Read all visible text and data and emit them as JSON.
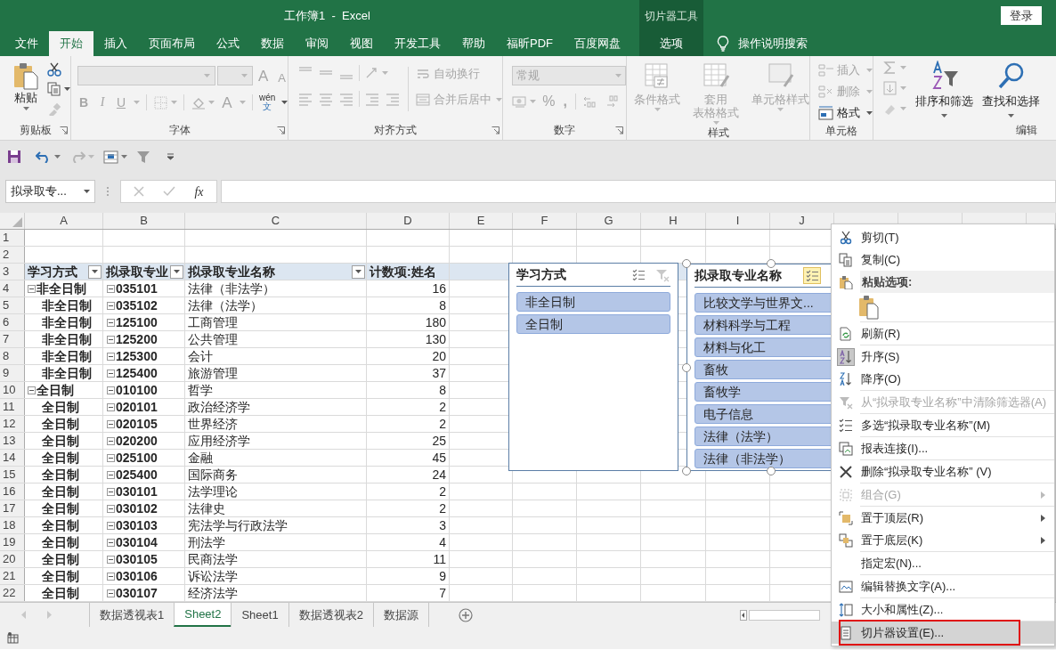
{
  "window": {
    "title": "工作簿1  -  Excel",
    "sign_in": "登录"
  },
  "ribbon_tabs": [
    {
      "label": "文件",
      "selected": false
    },
    {
      "label": "开始",
      "selected": true
    },
    {
      "label": "插入",
      "selected": false
    },
    {
      "label": "页面布局",
      "selected": false
    },
    {
      "label": "公式",
      "selected": false
    },
    {
      "label": "数据",
      "selected": false
    },
    {
      "label": "审阅",
      "selected": false
    },
    {
      "label": "视图",
      "selected": false
    },
    {
      "label": "开发工具",
      "selected": false
    },
    {
      "label": "帮助",
      "selected": false
    },
    {
      "label": "福昕PDF",
      "selected": false
    },
    {
      "label": "百度网盘",
      "selected": false
    }
  ],
  "contextual_group": {
    "label": "切片器工具",
    "tabs": [
      {
        "label": "选项",
        "selected": false
      }
    ]
  },
  "tell_me": "操作说明搜索",
  "ribbon": {
    "clipboard": {
      "label": "剪贴板",
      "paste": "粘贴"
    },
    "font": {
      "label": "字体",
      "disabled": true,
      "grow": "A",
      "shrink": "A",
      "bold": "B",
      "italic": "I",
      "underline": "U",
      "font_color": "A",
      "phonetic_top": "wén",
      "phonetic_bottom": "文"
    },
    "alignment": {
      "label": "对齐方式",
      "disabled": true,
      "wrap_text": "自动换行",
      "merge_center": "合并后居中"
    },
    "number": {
      "label": "数字",
      "disabled": true,
      "format": "常规",
      "percent": "%",
      "comma": ","
    },
    "styles": {
      "label": "样式",
      "disabled": true,
      "conditional": "条件格式",
      "table_line1": "套用",
      "table_line2": "表格格式",
      "cell_styles": "单元格样式"
    },
    "cells": {
      "label": "单元格",
      "items": [
        {
          "label": "插入",
          "disabled": true
        },
        {
          "label": "删除",
          "disabled": true
        },
        {
          "label": "格式",
          "disabled": false
        }
      ]
    },
    "editing": {
      "label": "编辑",
      "sort_filter": "排序和筛选",
      "find_select": "查找和选择"
    }
  },
  "formula_bar": {
    "name_box": "拟录取专...",
    "function_label": "fx"
  },
  "column_headers": [
    "A",
    "B",
    "C",
    "D",
    "E",
    "F",
    "G",
    "H",
    "I",
    "J"
  ],
  "row_numbers": [
    "1",
    "2",
    "3",
    "4",
    "5",
    "6",
    "7",
    "8",
    "9",
    "10",
    "11",
    "12",
    "13",
    "14",
    "15",
    "16",
    "17",
    "18",
    "19",
    "20",
    "21",
    "22"
  ],
  "pivot": {
    "headers": [
      {
        "label": "学习方式",
        "filter_button": true
      },
      {
        "label": "拟录取专业",
        "filter_button": true
      },
      {
        "label": "拟录取专业名称",
        "filter_button": true
      },
      {
        "label": "计数项:姓名",
        "filter_button": false
      }
    ],
    "rows": [
      {
        "mode": "非全日制",
        "group_start": true,
        "code": "035101",
        "name": "法律（非法学）",
        "count": "16"
      },
      {
        "mode": "非全日制",
        "group_start": false,
        "code": "035102",
        "name": "法律（法学）",
        "count": "8"
      },
      {
        "mode": "非全日制",
        "group_start": false,
        "code": "125100",
        "name": "工商管理",
        "count": "180"
      },
      {
        "mode": "非全日制",
        "group_start": false,
        "code": "125200",
        "name": "公共管理",
        "count": "130"
      },
      {
        "mode": "非全日制",
        "group_start": false,
        "code": "125300",
        "name": "会计",
        "count": "20"
      },
      {
        "mode": "非全日制",
        "group_start": false,
        "code": "125400",
        "name": "旅游管理",
        "count": "37"
      },
      {
        "mode": "全日制",
        "group_start": true,
        "code": "010100",
        "name": "哲学",
        "count": "8"
      },
      {
        "mode": "全日制",
        "group_start": false,
        "code": "020101",
        "name": "政治经济学",
        "count": "2"
      },
      {
        "mode": "全日制",
        "group_start": false,
        "code": "020105",
        "name": "世界经济",
        "count": "2"
      },
      {
        "mode": "全日制",
        "group_start": false,
        "code": "020200",
        "name": "应用经济学",
        "count": "25"
      },
      {
        "mode": "全日制",
        "group_start": false,
        "code": "025100",
        "name": "金融",
        "count": "45"
      },
      {
        "mode": "全日制",
        "group_start": false,
        "code": "025400",
        "name": "国际商务",
        "count": "24"
      },
      {
        "mode": "全日制",
        "group_start": false,
        "code": "030101",
        "name": "法学理论",
        "count": "2"
      },
      {
        "mode": "全日制",
        "group_start": false,
        "code": "030102",
        "name": "法律史",
        "count": "2"
      },
      {
        "mode": "全日制",
        "group_start": false,
        "code": "030103",
        "name": "宪法学与行政法学",
        "count": "3"
      },
      {
        "mode": "全日制",
        "group_start": false,
        "code": "030104",
        "name": "刑法学",
        "count": "4"
      },
      {
        "mode": "全日制",
        "group_start": false,
        "code": "030105",
        "name": "民商法学",
        "count": "11"
      },
      {
        "mode": "全日制",
        "group_start": false,
        "code": "030106",
        "name": "诉讼法学",
        "count": "9"
      },
      {
        "mode": "全日制",
        "group_start": false,
        "code": "030107",
        "name": "经济法学",
        "count": "7"
      }
    ]
  },
  "slicers": [
    {
      "title": "学习方式",
      "selected": false,
      "multi_select": false,
      "clear_filter": {
        "disabled": true
      },
      "items": [
        {
          "label": "非全日制",
          "selected": true
        },
        {
          "label": "全日制",
          "selected": true
        }
      ]
    },
    {
      "title": "拟录取专业名称",
      "selected": true,
      "multi_select": true,
      "items": [
        {
          "label": "比较文学与世界文...",
          "selected": true
        },
        {
          "label": "材料科学与工程",
          "selected": true
        },
        {
          "label": "材料与化工",
          "selected": true
        },
        {
          "label": "畜牧",
          "selected": true
        },
        {
          "label": "畜牧学",
          "selected": true
        },
        {
          "label": "电子信息",
          "selected": true
        },
        {
          "label": "法律（法学）",
          "selected": true
        },
        {
          "label": "法律（非法学）",
          "selected": true
        }
      ]
    }
  ],
  "context_menu": {
    "groups": [
      [
        {
          "kind": "item",
          "label": "剪切(T)",
          "disabled": false,
          "submenu": false,
          "checked": false,
          "hovered": false,
          "annotated": false
        },
        {
          "kind": "item",
          "label": "复制(C)",
          "disabled": false,
          "submenu": false,
          "checked": false,
          "hovered": false,
          "annotated": false
        },
        {
          "kind": "header",
          "label": "粘贴选项:"
        },
        {
          "kind": "paste-options"
        }
      ],
      [
        {
          "kind": "item",
          "label": "刷新(R)",
          "disabled": false,
          "submenu": false,
          "checked": false,
          "hovered": false,
          "annotated": false
        }
      ],
      [
        {
          "kind": "item",
          "label": "升序(S)",
          "disabled": false,
          "submenu": false,
          "checked": true,
          "hovered": false,
          "annotated": false
        },
        {
          "kind": "item",
          "label": "降序(O)",
          "disabled": false,
          "submenu": false,
          "checked": false,
          "hovered": false,
          "annotated": false
        }
      ],
      [
        {
          "kind": "item",
          "label": "从“拟录取专业名称”中清除筛选器(A)",
          "disabled": true,
          "submenu": false,
          "checked": false,
          "hovered": false,
          "annotated": false
        }
      ],
      [
        {
          "kind": "item",
          "label": "多选“拟录取专业名称”(M)",
          "disabled": false,
          "submenu": false,
          "checked": false,
          "hovered": false,
          "annotated": false
        }
      ],
      [
        {
          "kind": "item",
          "label": "报表连接(I)...",
          "disabled": false,
          "submenu": false,
          "checked": false,
          "hovered": false,
          "annotated": false
        }
      ],
      [
        {
          "kind": "item",
          "label": "删除“拟录取专业名称” (V)",
          "disabled": false,
          "submenu": false,
          "checked": false,
          "hovered": false,
          "annotated": false
        }
      ],
      [
        {
          "kind": "item",
          "label": "组合(G)",
          "disabled": true,
          "submenu": true,
          "checked": false,
          "hovered": false,
          "annotated": false
        }
      ],
      [
        {
          "kind": "item",
          "label": "置于顶层(R)",
          "disabled": false,
          "submenu": true,
          "checked": false,
          "hovered": false,
          "annotated": false
        },
        {
          "kind": "item",
          "label": "置于底层(K)",
          "disabled": false,
          "submenu": true,
          "checked": false,
          "hovered": false,
          "annotated": false
        }
      ],
      [
        {
          "kind": "item",
          "label": "指定宏(N)...",
          "disabled": false,
          "submenu": false,
          "checked": false,
          "hovered": false,
          "annotated": false
        }
      ],
      [
        {
          "kind": "item",
          "label": "编辑替换文字(A)...",
          "disabled": false,
          "submenu": false,
          "checked": false,
          "hovered": false,
          "annotated": false
        }
      ],
      [
        {
          "kind": "item",
          "label": "大小和属性(Z)...",
          "disabled": false,
          "submenu": false,
          "checked": false,
          "hovered": false,
          "annotated": false
        }
      ],
      [
        {
          "kind": "item",
          "label": "切片器设置(E)...",
          "disabled": false,
          "submenu": false,
          "checked": false,
          "hovered": true,
          "annotated": true
        }
      ]
    ]
  },
  "sheet_tabs": [
    {
      "label": "数据透视表1",
      "selected": false
    },
    {
      "label": "Sheet2",
      "selected": true
    },
    {
      "label": "Sheet1",
      "selected": false
    },
    {
      "label": "数据透视表2",
      "selected": false
    },
    {
      "label": "数据源",
      "selected": false
    }
  ]
}
